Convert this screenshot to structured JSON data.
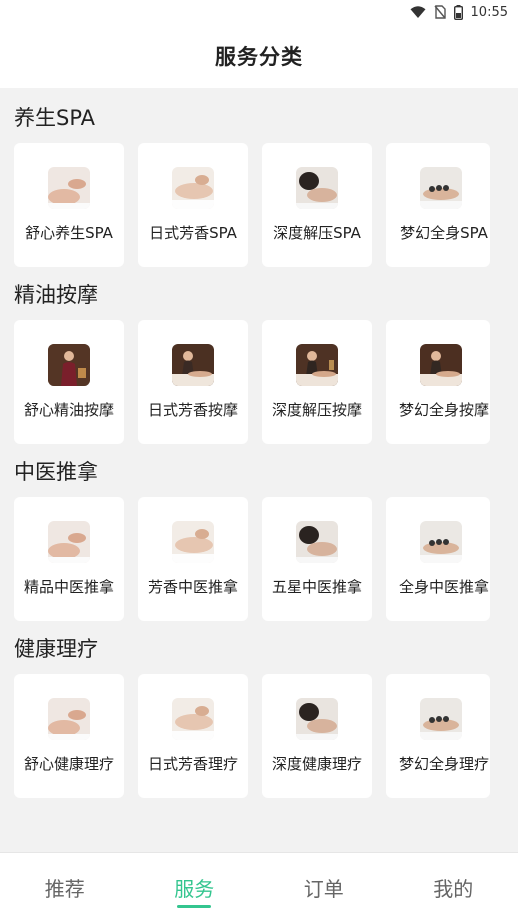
{
  "status_bar": {
    "time": "10:55",
    "icons": [
      "wifi-icon",
      "no-sim-icon",
      "battery-icon"
    ]
  },
  "header": {
    "title": "服务分类"
  },
  "sections": [
    {
      "title": "养生SPA",
      "items": [
        {
          "label": "舒心养生SPA",
          "icon": "massage-photo-icon"
        },
        {
          "label": "日式芳香SPA",
          "icon": "massage-photo-icon"
        },
        {
          "label": "深度解压SPA",
          "icon": "massage-photo-icon"
        },
        {
          "label": "梦幻全身SPA",
          "icon": "massage-photo-icon"
        }
      ]
    },
    {
      "title": "精油按摩",
      "items": [
        {
          "label": "舒心精油按摩",
          "icon": "therapist-photo-icon"
        },
        {
          "label": "日式芳香按摩",
          "icon": "therapist-photo-icon"
        },
        {
          "label": "深度解压按摩",
          "icon": "therapist-photo-icon"
        },
        {
          "label": "梦幻全身按摩",
          "icon": "therapist-photo-icon"
        }
      ]
    },
    {
      "title": "中医推拿",
      "items": [
        {
          "label": "精品中医推拿",
          "icon": "massage-photo-icon"
        },
        {
          "label": "芳香中医推拿",
          "icon": "massage-photo-icon"
        },
        {
          "label": "五星中医推拿",
          "icon": "massage-photo-icon"
        },
        {
          "label": "全身中医推拿",
          "icon": "massage-photo-icon"
        }
      ]
    },
    {
      "title": "健康理疗",
      "items": [
        {
          "label": "舒心健康理疗",
          "icon": "massage-photo-icon"
        },
        {
          "label": "日式芳香理疗",
          "icon": "massage-photo-icon"
        },
        {
          "label": "深度健康理疗",
          "icon": "massage-photo-icon"
        },
        {
          "label": "梦幻全身理疗",
          "icon": "massage-photo-icon"
        }
      ]
    }
  ],
  "tabbar": {
    "tabs": [
      {
        "label": "推荐"
      },
      {
        "label": "服务"
      },
      {
        "label": "订单"
      },
      {
        "label": "我的"
      }
    ],
    "active_index": 1,
    "active_color": "#34c58f",
    "inactive_color": "#666666"
  }
}
